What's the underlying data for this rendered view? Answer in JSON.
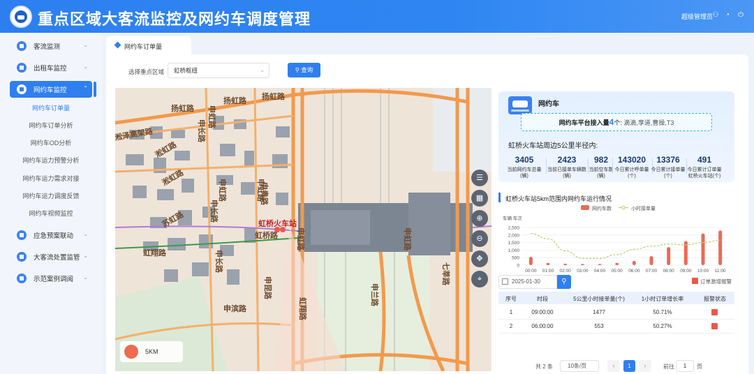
{
  "header": {
    "title": "重点区域大客流监控及网约车调度管理",
    "user": "超级管理员"
  },
  "sidebar": {
    "items": [
      {
        "label": "客流监测"
      },
      {
        "label": "出租车监控"
      },
      {
        "label": "网约车监控"
      },
      {
        "label": "应急预案联动"
      },
      {
        "label": "大客流处置监管"
      },
      {
        "label": "示范案例调阅"
      }
    ],
    "sub_items": [
      {
        "label": "网约车订单量"
      },
      {
        "label": "网约车订单分析"
      },
      {
        "label": "网约车OD分析"
      },
      {
        "label": "网约车运力预警分析"
      },
      {
        "label": "网约车运力需求对接"
      },
      {
        "label": "网约车运力调度反馈"
      },
      {
        "label": "网约车视频监控"
      }
    ]
  },
  "tab": {
    "label": "网约车订单量"
  },
  "filter": {
    "label": "选择重点区域",
    "value": "虹桥枢纽",
    "query_label": "查询"
  },
  "map": {
    "labels": [
      "扬虹路",
      "扬虹路",
      "扬虹路",
      "申虹路",
      "申长路",
      "申虹路",
      "申长路",
      "淞虹路",
      "淞虹路",
      "虹翔路",
      "申贵路",
      "申昆路",
      "申滨路",
      "虹桥火车站",
      "七莘路",
      "申兰路",
      "申虹路",
      "申长路",
      "淞泽高架路",
      "苏虹路",
      "虹桥路",
      "申虹路",
      "虹翔路",
      "申虹路"
    ],
    "legend": "5KM"
  },
  "car": {
    "title": "网约车",
    "platform_prefix": "网约车平台接入量",
    "platform_count": "4",
    "platform_unit": "个:",
    "platform_names": "滴滴,享道,曹操,T3",
    "radius_title": "虹桥火车站周边5公里半径内:",
    "stats": [
      {
        "value": "3405",
        "label1": "当前网约车总量",
        "label2": "(辆)"
      },
      {
        "value": "2423",
        "label1": "当前已接单车辆数",
        "label2": "(辆)"
      },
      {
        "value": "982",
        "label1": "当前空车数",
        "label2": "(辆)"
      },
      {
        "value": "143020",
        "label1": "今日累计呼单量",
        "label2": "(个)"
      },
      {
        "value": "13376",
        "label1": "今日累计接单量",
        "label2": "(个)"
      },
      {
        "value": "491",
        "label1": "今日累计订单量",
        "label2": "虹桥火车站(个)"
      }
    ]
  },
  "chart_data": {
    "type": "bar",
    "title": "虹桥火车站5km范围内网约车运行情况",
    "ylabel": "车辆:车次",
    "categories": [
      "00:00",
      "01:00",
      "02:00",
      "03:00",
      "04:00",
      "05:00",
      "06:00",
      "07:00",
      "08:00",
      "09:00",
      "10:00",
      "11:00"
    ],
    "series": [
      {
        "name": "网约车数",
        "type": "bar",
        "color": "#e86b55",
        "values": [
          550,
          150,
          100,
          80,
          80,
          150,
          280,
          600,
          1200,
          1600,
          2100,
          2300
        ]
      },
      {
        "name": "小时接单量",
        "type": "line",
        "color": "#b5d36b",
        "values": [
          2100,
          1750,
          950,
          450,
          450,
          700,
          1050,
          1250,
          1400,
          1350,
          1500,
          1650
        ]
      }
    ],
    "yticks": [
      "0",
      "500",
      "1,000",
      "1,500",
      "2,000",
      "2,500"
    ],
    "ylim": [
      0,
      2500
    ]
  },
  "date_filter": {
    "value": "2025-01-30",
    "alert_label": "订单激增报警"
  },
  "table": {
    "headers": [
      "序号",
      "时段",
      "5公里小时接单量(个)",
      "1小时订单增长率",
      "报警状态"
    ],
    "rows": [
      [
        "1",
        "09:00:00",
        "1477",
        "50.71%"
      ],
      [
        "2",
        "06:00:00",
        "553",
        "50.27%"
      ]
    ]
  },
  "pager": {
    "total": "共 2 条",
    "size": "10条/页",
    "current": "1",
    "goto_pre": "前往",
    "goto_value": "1",
    "goto_post": "页"
  }
}
